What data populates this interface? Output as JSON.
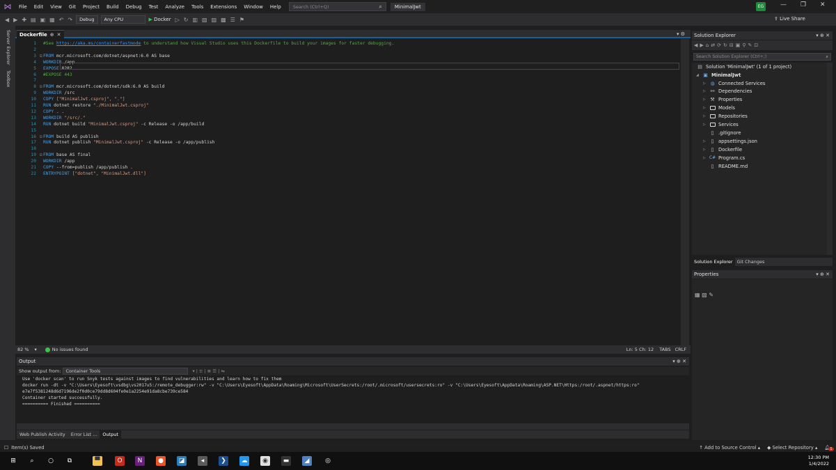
{
  "menubar": {
    "items": [
      "File",
      "Edit",
      "View",
      "Git",
      "Project",
      "Build",
      "Debug",
      "Test",
      "Analyze",
      "Tools",
      "Extensions",
      "Window",
      "Help"
    ],
    "search_placeholder": "Search (Ctrl+Q)",
    "solution_name": "MinimalJwt",
    "user_initials": "EG"
  },
  "toolbar": {
    "config": "Debug",
    "platform": "Any CPU",
    "run_label": "Docker",
    "live_share": "Live Share"
  },
  "left_rail": [
    "Server Explorer",
    "Toolbox"
  ],
  "editor": {
    "tab_title": "Dockerfile",
    "lines": [
      {
        "n": "1",
        "segs": [
          {
            "t": "#See ",
            "c": "cm"
          },
          {
            "t": "https://aka.ms/containerfastmode",
            "c": "lk"
          },
          {
            "t": " to understand how Visual Studio uses this Dockerfile to build your images for faster debugging.",
            "c": "cm"
          }
        ]
      },
      {
        "n": "2",
        "segs": []
      },
      {
        "n": "3",
        "segs": [
          {
            "t": "FROM",
            "c": "kw"
          },
          {
            "t": " mcr.microsoft.com/dotnet/aspnet:6.0 AS base",
            "c": ""
          }
        ]
      },
      {
        "n": "4",
        "segs": [
          {
            "t": "WORKDIR",
            "c": "kw"
          },
          {
            "t": " /app",
            "c": ""
          }
        ]
      },
      {
        "n": "5",
        "segs": [
          {
            "t": "EXPOSE",
            "c": "kw"
          },
          {
            "t": " 8282",
            "c": ""
          }
        ]
      },
      {
        "n": "6",
        "segs": [
          {
            "t": "#EXPOSE 443",
            "c": "cm"
          }
        ]
      },
      {
        "n": "7",
        "segs": []
      },
      {
        "n": "8",
        "segs": [
          {
            "t": "FROM",
            "c": "kw"
          },
          {
            "t": " mcr.microsoft.com/dotnet/sdk:6.0 AS build",
            "c": ""
          }
        ]
      },
      {
        "n": "9",
        "segs": [
          {
            "t": "WORKDIR",
            "c": "kw"
          },
          {
            "t": " /src",
            "c": ""
          }
        ]
      },
      {
        "n": "10",
        "segs": [
          {
            "t": "COPY",
            "c": "kw"
          },
          {
            "t": " [\"MinimalJwt.csproj\", \".\"]",
            "c": "st"
          }
        ]
      },
      {
        "n": "11",
        "segs": [
          {
            "t": "RUN",
            "c": "kw"
          },
          {
            "t": " dotnet restore ",
            "c": ""
          },
          {
            "t": "\"./MinimalJwt.csproj\"",
            "c": "st"
          }
        ]
      },
      {
        "n": "12",
        "segs": [
          {
            "t": "COPY",
            "c": "kw"
          },
          {
            "t": " . .",
            "c": ""
          }
        ]
      },
      {
        "n": "13",
        "segs": [
          {
            "t": "WORKDIR",
            "c": "kw"
          },
          {
            "t": " \"/src/.\"",
            "c": "st"
          }
        ]
      },
      {
        "n": "14",
        "segs": [
          {
            "t": "RUN",
            "c": "kw"
          },
          {
            "t": " dotnet build ",
            "c": ""
          },
          {
            "t": "\"MinimalJwt.csproj\"",
            "c": "st"
          },
          {
            "t": " -c Release -o /app/build",
            "c": ""
          }
        ]
      },
      {
        "n": "15",
        "segs": []
      },
      {
        "n": "16",
        "segs": [
          {
            "t": "FROM",
            "c": "kw"
          },
          {
            "t": " build AS publish",
            "c": ""
          }
        ]
      },
      {
        "n": "17",
        "segs": [
          {
            "t": "RUN",
            "c": "kw"
          },
          {
            "t": " dotnet publish ",
            "c": ""
          },
          {
            "t": "\"MinimalJwt.csproj\"",
            "c": "st"
          },
          {
            "t": " -c Release -o /app/publish",
            "c": ""
          }
        ]
      },
      {
        "n": "18",
        "segs": []
      },
      {
        "n": "19",
        "segs": [
          {
            "t": "FROM",
            "c": "kw"
          },
          {
            "t": " base AS final",
            "c": ""
          }
        ]
      },
      {
        "n": "20",
        "segs": [
          {
            "t": "WORKDIR",
            "c": "kw"
          },
          {
            "t": " /app",
            "c": ""
          }
        ]
      },
      {
        "n": "21",
        "segs": [
          {
            "t": "COPY",
            "c": "kw"
          },
          {
            "t": " --from=publish /app/publish .",
            "c": ""
          }
        ]
      },
      {
        "n": "22",
        "segs": [
          {
            "t": "ENTRYPOINT",
            "c": "kw"
          },
          {
            "t": " [\"dotnet\", \"MinimalJwt.dll\"]",
            "c": "st"
          }
        ]
      }
    ],
    "folds": [
      "3",
      "8",
      "16",
      "19"
    ]
  },
  "editor_status": {
    "zoom": "82 %",
    "issues": "No issues found",
    "position": "Ln: 5   Ch: 12",
    "indent": "TABS",
    "eol": "CRLF"
  },
  "output": {
    "title": "Output",
    "show_from_label": "Show output from:",
    "source": "Container Tools",
    "lines": [
      "Use 'docker scan' to run Snyk tests against images to find vulnerabilities and learn how to fix them",
      "docker run -dt -v \"C:\\Users\\Eyesoft\\vsdbg\\vs2017u5:/remote_debugger:rw\" -v \"C:\\Users\\Eyesoft\\AppData\\Roaming\\Microsoft\\UserSecrets:/root/.microsoft/usersecrets:ro\" -v \"C:\\Users\\Eyesoft\\AppData\\Roaming\\ASP.NET\\Https:/root/.aspnet/https:ro\"",
      "e7e7f5381248d6d7196de2f0d0ce79dd8d604fe0e1a2254e91da8cbe739ce584",
      "Container started successfully.",
      "========== Finished =========="
    ]
  },
  "bottom_tabs": [
    "Web Publish Activity",
    "Error List ...",
    "Output"
  ],
  "solution_explorer": {
    "title": "Solution Explorer",
    "search_placeholder": "Search Solution Explorer (Ctrl+;)",
    "solution_label": "Solution 'MinimalJwt' (1 of 1 project)",
    "project_label": "MinimalJwt",
    "items": [
      {
        "label": "Connected Services",
        "icon": "connected-services-icon"
      },
      {
        "label": "Dependencies",
        "icon": "dependencies-icon"
      },
      {
        "label": "Properties",
        "icon": "properties-icon"
      },
      {
        "label": "Models",
        "icon": "folder-icon"
      },
      {
        "label": "Repositories",
        "icon": "folder-icon"
      },
      {
        "label": "Services",
        "icon": "folder-icon"
      },
      {
        "label": ".gitignore",
        "icon": "file-icon"
      },
      {
        "label": "appsettings.json",
        "icon": "json-file-icon"
      },
      {
        "label": "Dockerfile",
        "icon": "file-icon"
      },
      {
        "label": "Program.cs",
        "icon": "csharp-file-icon"
      },
      {
        "label": "README.md",
        "icon": "markdown-file-icon"
      }
    ],
    "tabs": [
      "Solution Explorer",
      "Git Changes"
    ]
  },
  "properties": {
    "title": "Properties"
  },
  "statusbar": {
    "message": "Item(s) Saved",
    "source_control": "Add to Source Control",
    "repository": "Select Repository",
    "notifications": "1"
  },
  "taskbar": {
    "time": "12:30 PM",
    "date": "1/4/2022"
  },
  "colors": {
    "accent": "#0e639c",
    "keyword": "#569cd6",
    "comment": "#57a64a",
    "string": "#d69d85",
    "vs_purple": "#68217a"
  }
}
